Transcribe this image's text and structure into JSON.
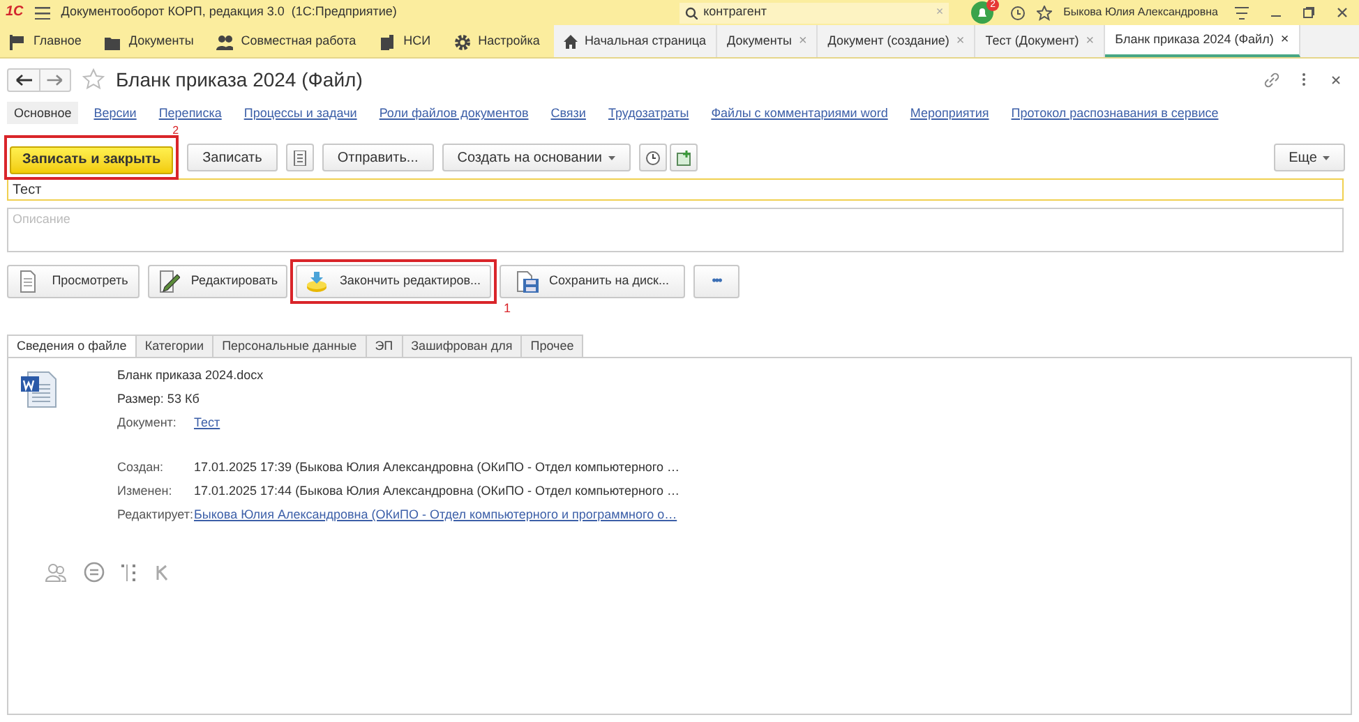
{
  "app_bar": {
    "logo": "1С",
    "title": "Документооборот КОРП, редакция 3.0  (1С:Предприятие)",
    "search": {
      "value": "контрагент",
      "clear": "×"
    },
    "notifications": "2",
    "user": "Быкова Юлия Александровна"
  },
  "sections": [
    {
      "label": "Главное"
    },
    {
      "label": "Документы"
    },
    {
      "label": "Совместная работа"
    },
    {
      "label": "НСИ"
    },
    {
      "label": "Настройка"
    }
  ],
  "open_tabs": [
    {
      "label": "Начальная страница",
      "kind": "home",
      "selected": false
    },
    {
      "label": "Документы",
      "close": "×",
      "selected": false
    },
    {
      "label": "Документ (создание)",
      "close": "×",
      "selected": false
    },
    {
      "label": "Тест (Документ)",
      "close": "×",
      "selected": false
    },
    {
      "label": "Бланк приказа 2024 (Файл)",
      "close": "×",
      "selected": true
    }
  ],
  "form": {
    "title": "Бланк приказа 2024 (Файл)",
    "links": [
      {
        "label": "Основное",
        "selected": true
      },
      {
        "label": "Версии",
        "selected": false
      },
      {
        "label": "Переписка",
        "selected": false
      },
      {
        "label": "Процессы и задачи",
        "selected": false
      },
      {
        "label": "Роли файлов документов",
        "selected": false
      },
      {
        "label": "Связи",
        "selected": false
      },
      {
        "label": "Трудозатраты",
        "selected": false
      },
      {
        "label": "Файлы с комментариями word",
        "selected": false
      },
      {
        "label": "Мероприятия",
        "selected": false
      },
      {
        "label": "Протокол распознавания в сервисе",
        "selected": false
      }
    ],
    "toolbar": [
      {
        "kind": "primary",
        "label": "Записать и закрыть",
        "marker": "2"
      },
      {
        "kind": "text",
        "label": "Записать"
      },
      {
        "kind": "list"
      },
      {
        "kind": "text",
        "label": "Отправить..."
      },
      {
        "kind": "dropdown",
        "label": "Создать на основании"
      },
      {
        "kind": "clock"
      },
      {
        "kind": "add"
      }
    ],
    "more": "Еще",
    "name_value": "Тест",
    "description_placeholder": "Описание",
    "file_buttons": [
      {
        "label": "Просмотреть"
      },
      {
        "label": "Редактировать"
      },
      {
        "label": "Закончить редактиров...",
        "marker": "1"
      },
      {
        "label": "Сохранить на диск..."
      },
      {
        "label": "•••"
      }
    ],
    "tabs": [
      {
        "label": "Сведения о файле",
        "selected": true
      },
      {
        "label": "Категории",
        "selected": false
      },
      {
        "label": "Персональные данные",
        "selected": false
      },
      {
        "label": "ЭП",
        "selected": false
      },
      {
        "label": "Зашифрован для",
        "selected": false
      },
      {
        "label": "Прочее",
        "selected": false
      }
    ],
    "file_info": {
      "file_name": "Бланк приказа 2024.docx",
      "size": "Размер: 53 Кб",
      "rows": [
        {
          "label": "Документ:",
          "value": "Тест",
          "kind": "link"
        },
        {
          "label": "Создан:",
          "value": "17.01.2025 17:39 (Быкова Юлия Александровна (ОКиПО - Отдел компьютерного …",
          "kind": "text"
        },
        {
          "label": "Изменен:",
          "value": "17.01.2025 17:44 (Быкова Юлия Александровна (ОКиПО - Отдел компьютерного …",
          "kind": "text"
        },
        {
          "label": "Редактирует:",
          "value": "Быкова Юлия Александровна (ОКиПО - Отдел компьютерного и программного о…",
          "kind": "link"
        }
      ]
    }
  }
}
